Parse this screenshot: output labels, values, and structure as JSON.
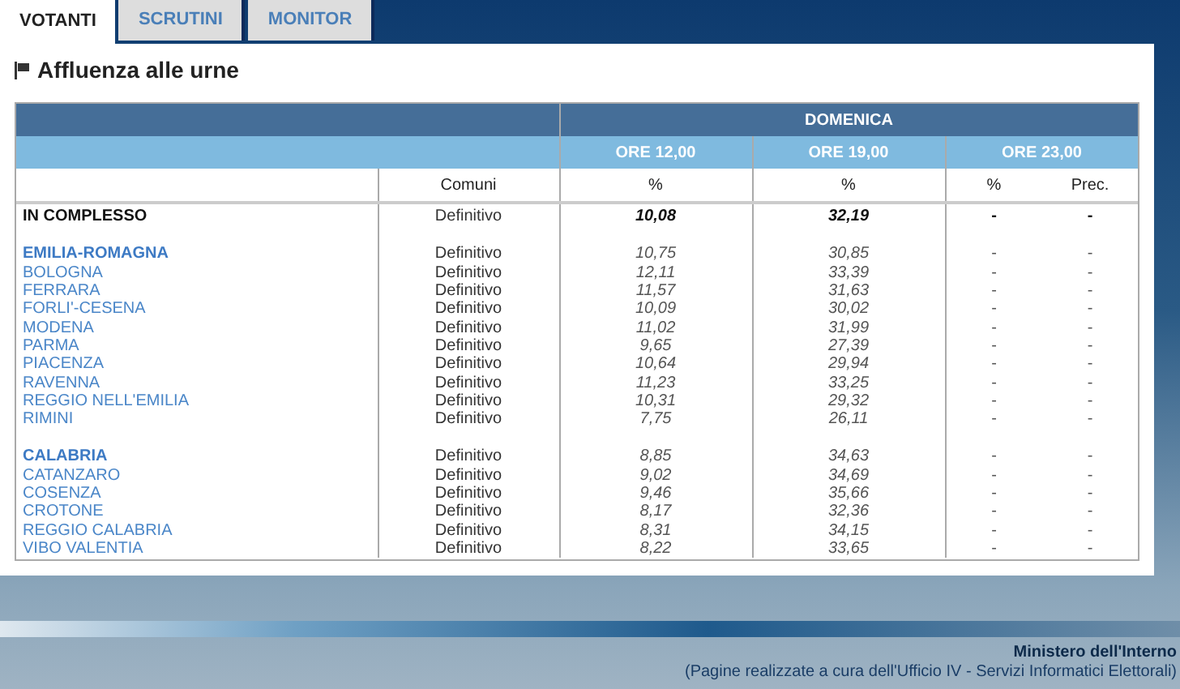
{
  "tabs": [
    {
      "label": "VOTANTI",
      "selected": true
    },
    {
      "label": "SCRUTINI",
      "selected": false
    },
    {
      "label": "MONITOR",
      "selected": false
    }
  ],
  "title": "Affluenza alle urne",
  "table": {
    "day": "DOMENICA",
    "times": [
      "ORE 12,00",
      "ORE 19,00",
      "ORE 23,00"
    ],
    "columns": [
      "Comuni",
      "%",
      "%",
      "%",
      "Prec."
    ],
    "total": {
      "name": "IN COMPLESSO",
      "status": "Definitivo",
      "values": [
        "10,08",
        "32,19",
        "-",
        "-"
      ]
    },
    "regions": [
      {
        "name": "EMILIA-ROMAGNA",
        "status": "Definitivo",
        "values": [
          "10,75",
          "30,85",
          "-",
          "-"
        ],
        "provinces": [
          {
            "name": "BOLOGNA",
            "status": "Definitivo",
            "values": [
              "12,11",
              "33,39",
              "-",
              "-"
            ]
          },
          {
            "name": "FERRARA",
            "status": "Definitivo",
            "values": [
              "11,57",
              "31,63",
              "-",
              "-"
            ]
          },
          {
            "name": "FORLI'-CESENA",
            "status": "Definitivo",
            "values": [
              "10,09",
              "30,02",
              "-",
              "-"
            ]
          },
          {
            "name": "MODENA",
            "status": "Definitivo",
            "values": [
              "11,02",
              "31,99",
              "-",
              "-"
            ]
          },
          {
            "name": "PARMA",
            "status": "Definitivo",
            "values": [
              "9,65",
              "27,39",
              "-",
              "-"
            ]
          },
          {
            "name": "PIACENZA",
            "status": "Definitivo",
            "values": [
              "10,64",
              "29,94",
              "-",
              "-"
            ]
          },
          {
            "name": "RAVENNA",
            "status": "Definitivo",
            "values": [
              "11,23",
              "33,25",
              "-",
              "-"
            ]
          },
          {
            "name": "REGGIO NELL'EMILIA",
            "status": "Definitivo",
            "values": [
              "10,31",
              "29,32",
              "-",
              "-"
            ]
          },
          {
            "name": "RIMINI",
            "status": "Definitivo",
            "values": [
              "7,75",
              "26,11",
              "-",
              "-"
            ]
          }
        ]
      },
      {
        "name": "CALABRIA",
        "status": "Definitivo",
        "values": [
          "8,85",
          "34,63",
          "-",
          "-"
        ],
        "provinces": [
          {
            "name": "CATANZARO",
            "status": "Definitivo",
            "values": [
              "9,02",
              "34,69",
              "-",
              "-"
            ]
          },
          {
            "name": "COSENZA",
            "status": "Definitivo",
            "values": [
              "9,46",
              "35,66",
              "-",
              "-"
            ]
          },
          {
            "name": "CROTONE",
            "status": "Definitivo",
            "values": [
              "8,17",
              "32,36",
              "-",
              "-"
            ]
          },
          {
            "name": "REGGIO CALABRIA",
            "status": "Definitivo",
            "values": [
              "8,31",
              "34,15",
              "-",
              "-"
            ]
          },
          {
            "name": "VIBO VALENTIA",
            "status": "Definitivo",
            "values": [
              "8,22",
              "33,65",
              "-",
              "-"
            ]
          }
        ]
      }
    ]
  },
  "footer": {
    "org": "Ministero dell'Interno",
    "credit": "(Pagine realizzate a cura dell'Ufficio IV - Servizi Informatici Elettorali)"
  }
}
